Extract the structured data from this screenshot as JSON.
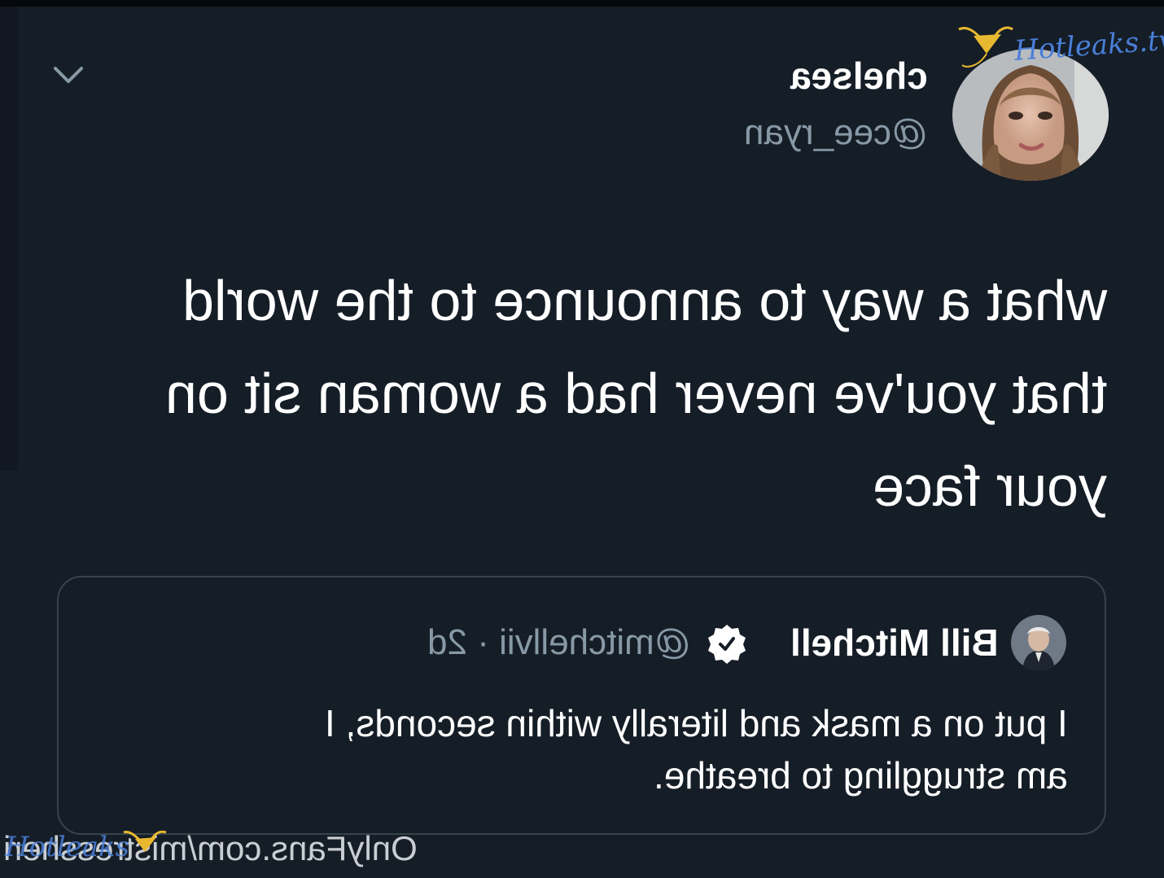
{
  "tweet": {
    "display_name": "chelsea",
    "handle": "@cee_ryan",
    "text_lines": [
      "what a way to announce to the world",
      "that you've never had a woman sit on",
      "your face"
    ],
    "menu_icon": "chevron-down-icon",
    "avatar_icon": "profile-photo"
  },
  "quoted_tweet": {
    "display_name": "Bill Mitchell",
    "verified_icon": "verified-badge-icon",
    "meta": "@mitchellvii · 2d",
    "text_lines": [
      "I put on a mask and literally within seconds, I",
      "am struggling to breathe."
    ]
  },
  "watermarks": {
    "top": "Hotleaks.tv",
    "bottom": "OnlyFans.com/mistressheri",
    "bottom_overlay": "Hotleaks"
  },
  "colors": {
    "background": "#151d27",
    "text_primary": "#ffffff",
    "text_secondary": "#8899a6",
    "card_border": "#37444c",
    "watermark_blue": "#4a7fd8",
    "watermark_gold": "#e8b830"
  }
}
